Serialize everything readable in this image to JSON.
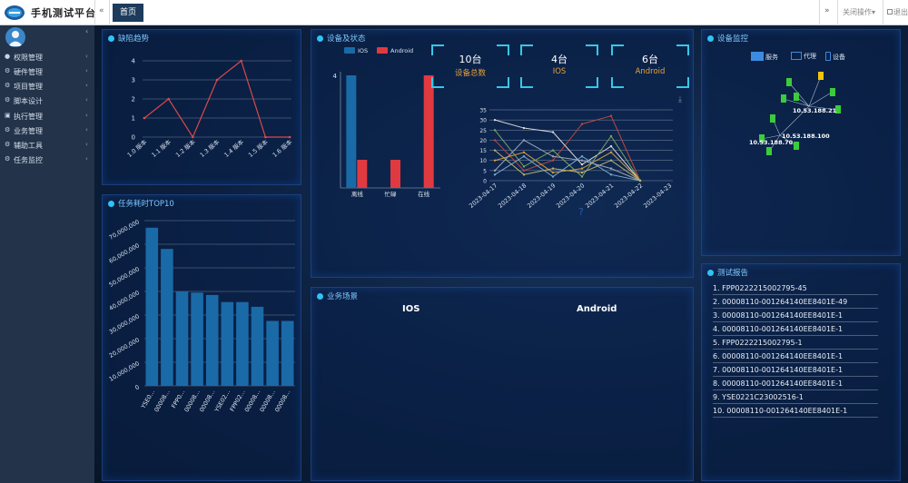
{
  "app": {
    "title": "手机测试平台",
    "logo_icon": "logo-icon",
    "nav_prev": "«",
    "home_tab": "首页",
    "nav_next": "»",
    "close_ops": "关闭操作▾",
    "logout": "退出"
  },
  "sidebar": {
    "collapse": "‹",
    "items": [
      {
        "label": "权限管理",
        "icon": "user-icon"
      },
      {
        "label": "硬件管理",
        "icon": "gear-icon"
      },
      {
        "label": "项目管理",
        "icon": "gear-icon"
      },
      {
        "label": "脚本设计",
        "icon": "gear-icon"
      },
      {
        "label": "执行管理",
        "icon": "briefcase-icon"
      },
      {
        "label": "业务管理",
        "icon": "gear-icon"
      },
      {
        "label": "辅助工具",
        "icon": "gear-icon"
      },
      {
        "label": "任务监控",
        "icon": "gear-icon"
      }
    ]
  },
  "panels": {
    "defect": {
      "title": "缺陷趋势"
    },
    "devices": {
      "title": "设备及状态"
    },
    "monitor": {
      "title": "设备监控"
    },
    "task": {
      "title": "任务耗时TOP10"
    },
    "scene": {
      "title": "业务场景",
      "ios": "IOS",
      "android": "Android"
    },
    "report": {
      "title": "测试报告"
    }
  },
  "stats": [
    {
      "value": "10台",
      "label": "设备总数"
    },
    {
      "value": "4台",
      "label": "IOS"
    },
    {
      "value": "6台",
      "label": "Android"
    }
  ],
  "monitor": {
    "legend": [
      {
        "label": "服务",
        "icon": "server-icon"
      },
      {
        "label": "代理",
        "icon": "monitor-icon"
      },
      {
        "label": "设备",
        "icon": "phone-icon"
      }
    ],
    "nodes": [
      "10.53.188.21",
      "10.53.188.100",
      "10.53.188.70"
    ]
  },
  "reports": [
    "1. FPP0222215002795-45",
    "2. 00008110-001264140EE8401E-49",
    "3. 00008110-001264140EE8401E-1",
    "4. 00008110-001264140EE8401E-1",
    "5. FPP0222215002795-1",
    "6. 00008110-001264140EE8401E-1",
    "7. 00008110-001264140EE8401E-1",
    "8. 00008110-001264140EE8401E-1",
    "9. YSE0221C23002516-1",
    "10. 00008110-001264140EE8401E-1"
  ],
  "chart_data": [
    {
      "type": "line",
      "categories": [
        "1.0 版本",
        "1.1 版本",
        "1.2 版本",
        "1.3 版本",
        "1.4 版本",
        "1.5 版本",
        "1.6 版本"
      ],
      "values": [
        1,
        2,
        0,
        3,
        4,
        0,
        0
      ],
      "ylim": [
        0,
        4
      ],
      "yticks": [
        "0",
        "1",
        "2",
        "3",
        "4"
      ],
      "grid": true,
      "color": "#d94a4a"
    },
    {
      "type": "bar",
      "categories": [
        "离线",
        "忙碌",
        "在线"
      ],
      "series": [
        {
          "name": "IOS",
          "values": [
            4,
            0,
            0
          ],
          "color": "#1a6aa8"
        },
        {
          "name": "Android",
          "values": [
            1,
            1,
            4
          ],
          "color": "#e03a40"
        }
      ],
      "ylim": [
        0,
        4
      ],
      "yticks": [
        "4"
      ],
      "legend": "top"
    },
    {
      "type": "line",
      "categories": [
        "2023-04-17",
        "2023-04-18",
        "2023-04-19",
        "2023-04-20",
        "2023-04-21",
        "2023-04-22",
        "2023-04-23"
      ],
      "ylim": [
        0,
        35
      ],
      "yticks": [
        "0",
        "5",
        "10",
        "15",
        "20",
        "25",
        "30",
        "35"
      ],
      "grid": true,
      "series": [
        {
          "values": [
            20,
            5,
            10,
            28,
            32,
            0
          ],
          "color": "#c0463f"
        },
        {
          "values": [
            30,
            26,
            24,
            8,
            17,
            0
          ],
          "color": "#d9d9d9"
        },
        {
          "values": [
            25,
            7,
            15,
            2,
            22,
            0
          ],
          "color": "#7ba65a"
        },
        {
          "values": [
            10,
            14,
            4,
            6,
            14,
            0
          ],
          "color": "#d39a3c"
        },
        {
          "values": [
            5,
            20,
            12,
            10,
            6,
            0
          ],
          "color": "#9aa3b5"
        },
        {
          "values": [
            3,
            12,
            2,
            12,
            3,
            0
          ],
          "color": "#7aa7c7"
        },
        {
          "values": [
            15,
            3,
            6,
            4,
            10,
            0
          ],
          "color": "#b7b06a"
        }
      ]
    },
    {
      "type": "bar",
      "categories": [
        "YSE0...",
        "00008...",
        "FPP0...",
        "00008...",
        "00008...",
        "YSE02...",
        "FPP02...",
        "00008...",
        "00008...",
        "00008..."
      ],
      "values": [
        67000000,
        58000000,
        40000000,
        39500000,
        38500000,
        35500000,
        35500000,
        33500000,
        27500000,
        27500000
      ],
      "ylim": [
        0,
        70000000
      ],
      "yticks": [
        "0",
        "10,000,000",
        "20,000,000",
        "30,000,000",
        "40,000,000",
        "50,000,000",
        "60,000,000",
        "70,000,000"
      ],
      "grid": true,
      "color": "#1a6aa8"
    }
  ]
}
